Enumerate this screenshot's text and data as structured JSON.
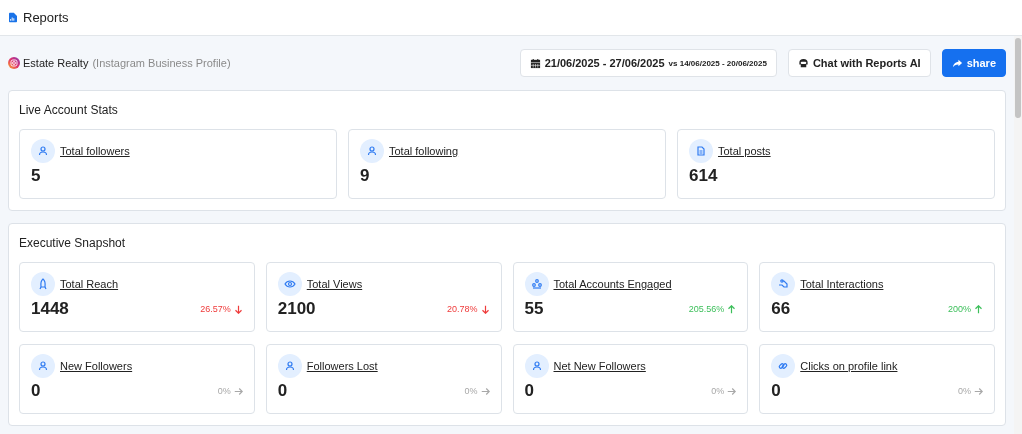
{
  "page_title": "Reports",
  "account": {
    "name": "Estate Realty",
    "type": "(Instagram Business Profile)"
  },
  "date_range": {
    "current": "21/06/2025 - 27/06/2025",
    "vs": "vs",
    "previous": "14/06/2025 - 20/06/2025"
  },
  "buttons": [
    {
      "label": "Chat with Reports AI",
      "kind": "chat"
    },
    {
      "label": "share",
      "kind": "share"
    }
  ],
  "sections": [
    {
      "title": "Live Account Stats",
      "cards": [
        {
          "label": "Total followers",
          "value": "5"
        },
        {
          "label": "Total following",
          "value": "9"
        },
        {
          "label": "Total posts",
          "value": "614"
        }
      ]
    },
    {
      "title": "Executive Snapshot",
      "cards": [
        {
          "label": "Total Reach",
          "value": "1448",
          "change": "26.57%",
          "kind": "down"
        },
        {
          "label": "Total Views",
          "value": "2100",
          "change": "20.78%",
          "kind": "down"
        },
        {
          "label": "Total Accounts Engaged",
          "value": "55",
          "change": "205.56%",
          "kind": "up"
        },
        {
          "label": "Total Interactions",
          "value": "66",
          "change": "200%",
          "kind": "up"
        },
        {
          "label": "New Followers",
          "value": "0",
          "change": "0%",
          "kind": "flat"
        },
        {
          "label": "Followers Lost",
          "value": "0",
          "change": "0%",
          "kind": "flat"
        },
        {
          "label": "Net New Followers",
          "value": "0",
          "change": "0%",
          "kind": "flat"
        },
        {
          "label": "Clicks on profile link",
          "value": "0",
          "change": "0%",
          "kind": "flat"
        }
      ]
    }
  ]
}
